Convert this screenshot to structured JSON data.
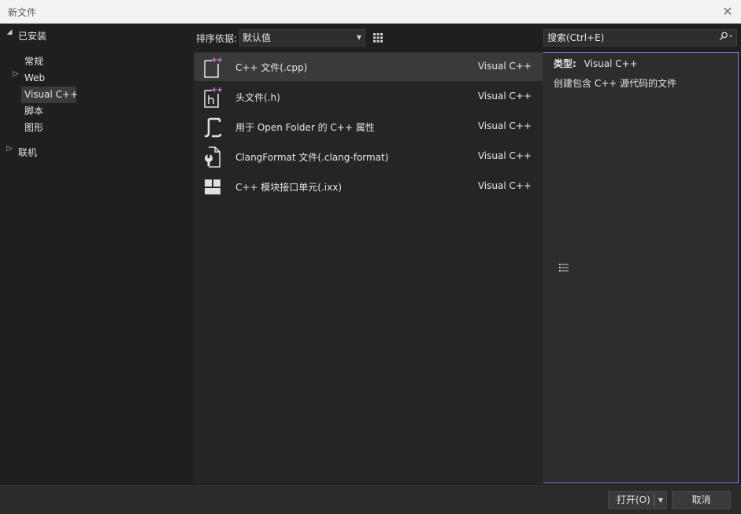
{
  "window": {
    "title": "新文件"
  },
  "tree": {
    "installed": "已安装",
    "items": [
      "常规",
      "Web",
      "Visual C++",
      "脚本",
      "图形"
    ],
    "online": "联机"
  },
  "toolbar": {
    "sort_label": "排序依据:",
    "sort_value": "默认值"
  },
  "templates": [
    {
      "name": "C++ 文件(.cpp)",
      "lang": "Visual C++",
      "icon": "cpp-file-icon"
    },
    {
      "name": "头文件(.h)",
      "lang": "Visual C++",
      "icon": "header-file-icon"
    },
    {
      "name": "用于 Open Folder 的 C++ 属性",
      "lang": "Visual C++",
      "icon": "json-properties-icon"
    },
    {
      "name": "ClangFormat 文件(.clang-format)",
      "lang": "Visual C++",
      "icon": "wrench-file-icon"
    },
    {
      "name": "C++ 模块接口单元(.ixx)",
      "lang": "Visual C++",
      "icon": "module-icon"
    }
  ],
  "search": {
    "placeholder": "搜索(Ctrl+E)"
  },
  "details": {
    "type_label": "类型:",
    "type_value": "Visual C++",
    "description": "创建包含 C++ 源代码的文件"
  },
  "footer": {
    "open_label": "打开(O)",
    "cancel_label": "取消"
  },
  "colors": {
    "accent": "#8a7cf0",
    "plus_badge": "#c86bc8"
  }
}
